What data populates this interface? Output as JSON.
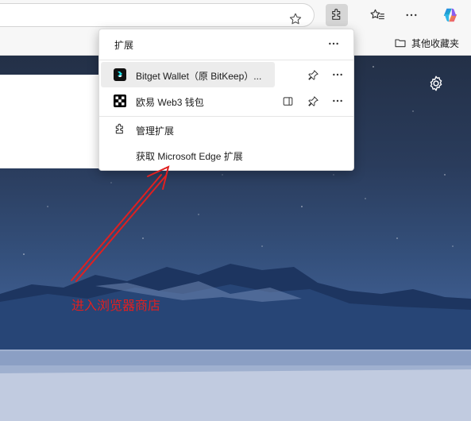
{
  "toolbar": {
    "other_favorites_label": "其他收藏夹"
  },
  "extensions_popup": {
    "title": "扩展",
    "items": [
      {
        "name": "Bitget Wallet（原 BitKeep）...",
        "icon": "bitget-wallet-icon"
      },
      {
        "name": "欧易 Web3 钱包",
        "icon": "okx-wallet-icon"
      }
    ],
    "manage_label": "管理扩展",
    "get_extensions_label": "获取 Microsoft Edge 扩展"
  },
  "annotation": {
    "text": "进入浏览器商店",
    "color": "#e02020"
  },
  "colors": {
    "toolbar_bg": "#f7f7f7",
    "extensions_button_active": "#d6d6d6",
    "row_highlight": "#ececec"
  }
}
